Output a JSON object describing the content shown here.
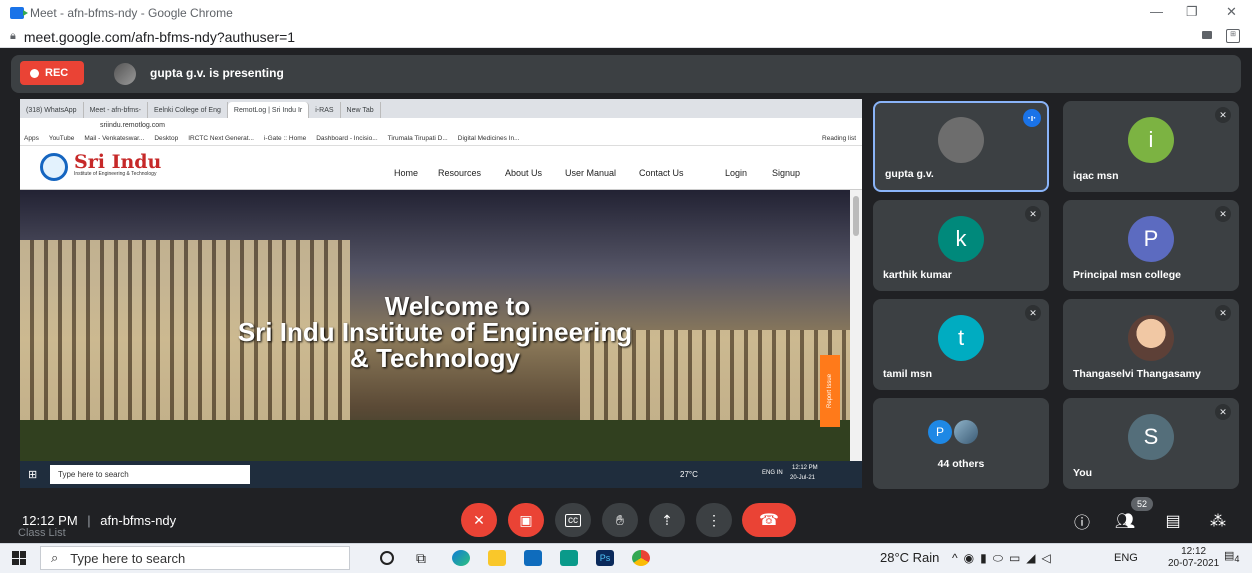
{
  "window": {
    "title": "Meet - afn-bfms-ndy - Google Chrome",
    "url": "meet.google.com/afn-bfms-ndy?authuser=1"
  },
  "banner": {
    "rec_label": "REC",
    "presenting_text": "gupta g.v. is presenting"
  },
  "presentation": {
    "tabs": [
      "(318) WhatsApp",
      "Meet - afn-bfms-",
      "Eelnki College of Eng",
      "RemotLog | Sri Indu Ir",
      "i-RAS",
      "New Tab"
    ],
    "url": "sriindu.remotlog.com",
    "bookmarks": [
      "Apps",
      "YouTube",
      "Mail - Venkateswar...",
      "Desktop",
      "IRCTC Next Generat...",
      "i-Gate :: Home",
      "Dashboard - Incisio...",
      "Tirumala Tirupati D...",
      "Digital Medicines In...",
      "Reading list"
    ],
    "site_name": "Sri Indu",
    "site_sub": "Institute of Engineering & Technology",
    "nav_links": [
      "Home",
      "Resources",
      "About Us",
      "User Manual",
      "Contact Us",
      "Login",
      "Signup"
    ],
    "hero_lines": [
      "Welcome to",
      "Sri Indu Institute of Engineering",
      "& Technology"
    ],
    "report_issue": "Report Issue",
    "taskbar_search": "Type here to search",
    "taskbar_weather": "27°C",
    "taskbar_lang": "ENG IN",
    "taskbar_time": "12:12 PM",
    "taskbar_date": "20-Jul-21"
  },
  "participants": [
    {
      "name": "gupta g.v.",
      "initial": "",
      "color": "#5f6368",
      "muted": false,
      "active": true
    },
    {
      "name": "iqac msn",
      "initial": "i",
      "color": "#7cb342",
      "muted": true,
      "active": false
    },
    {
      "name": "karthik kumar",
      "initial": "k",
      "color": "#00897b",
      "muted": true,
      "active": false
    },
    {
      "name": "Principal msn college",
      "initial": "P",
      "color": "#5c6bc0",
      "muted": true,
      "active": false
    },
    {
      "name": "tamil msn",
      "initial": "t",
      "color": "#00acc1",
      "muted": true,
      "active": false
    },
    {
      "name": "Thangaselvi Thangasamy",
      "initial": "",
      "color": "#8d6e63",
      "muted": true,
      "active": false
    },
    {
      "name": "44 others",
      "initial": "P",
      "color": "#1e88e5",
      "muted": false,
      "active": false
    },
    {
      "name": "You",
      "initial": "S",
      "color": "#546e7a",
      "muted": true,
      "active": false
    }
  ],
  "meeting": {
    "time": "12:12 PM",
    "code": "afn-bfms-ndy",
    "participant_count": "52",
    "class_list": "Class List"
  },
  "os_taskbar": {
    "search_placeholder": "Type here to search",
    "weather": "28°C Rain",
    "lang": "ENG",
    "time": "12:12",
    "date": "20-07-2021",
    "notif_count": "4"
  }
}
